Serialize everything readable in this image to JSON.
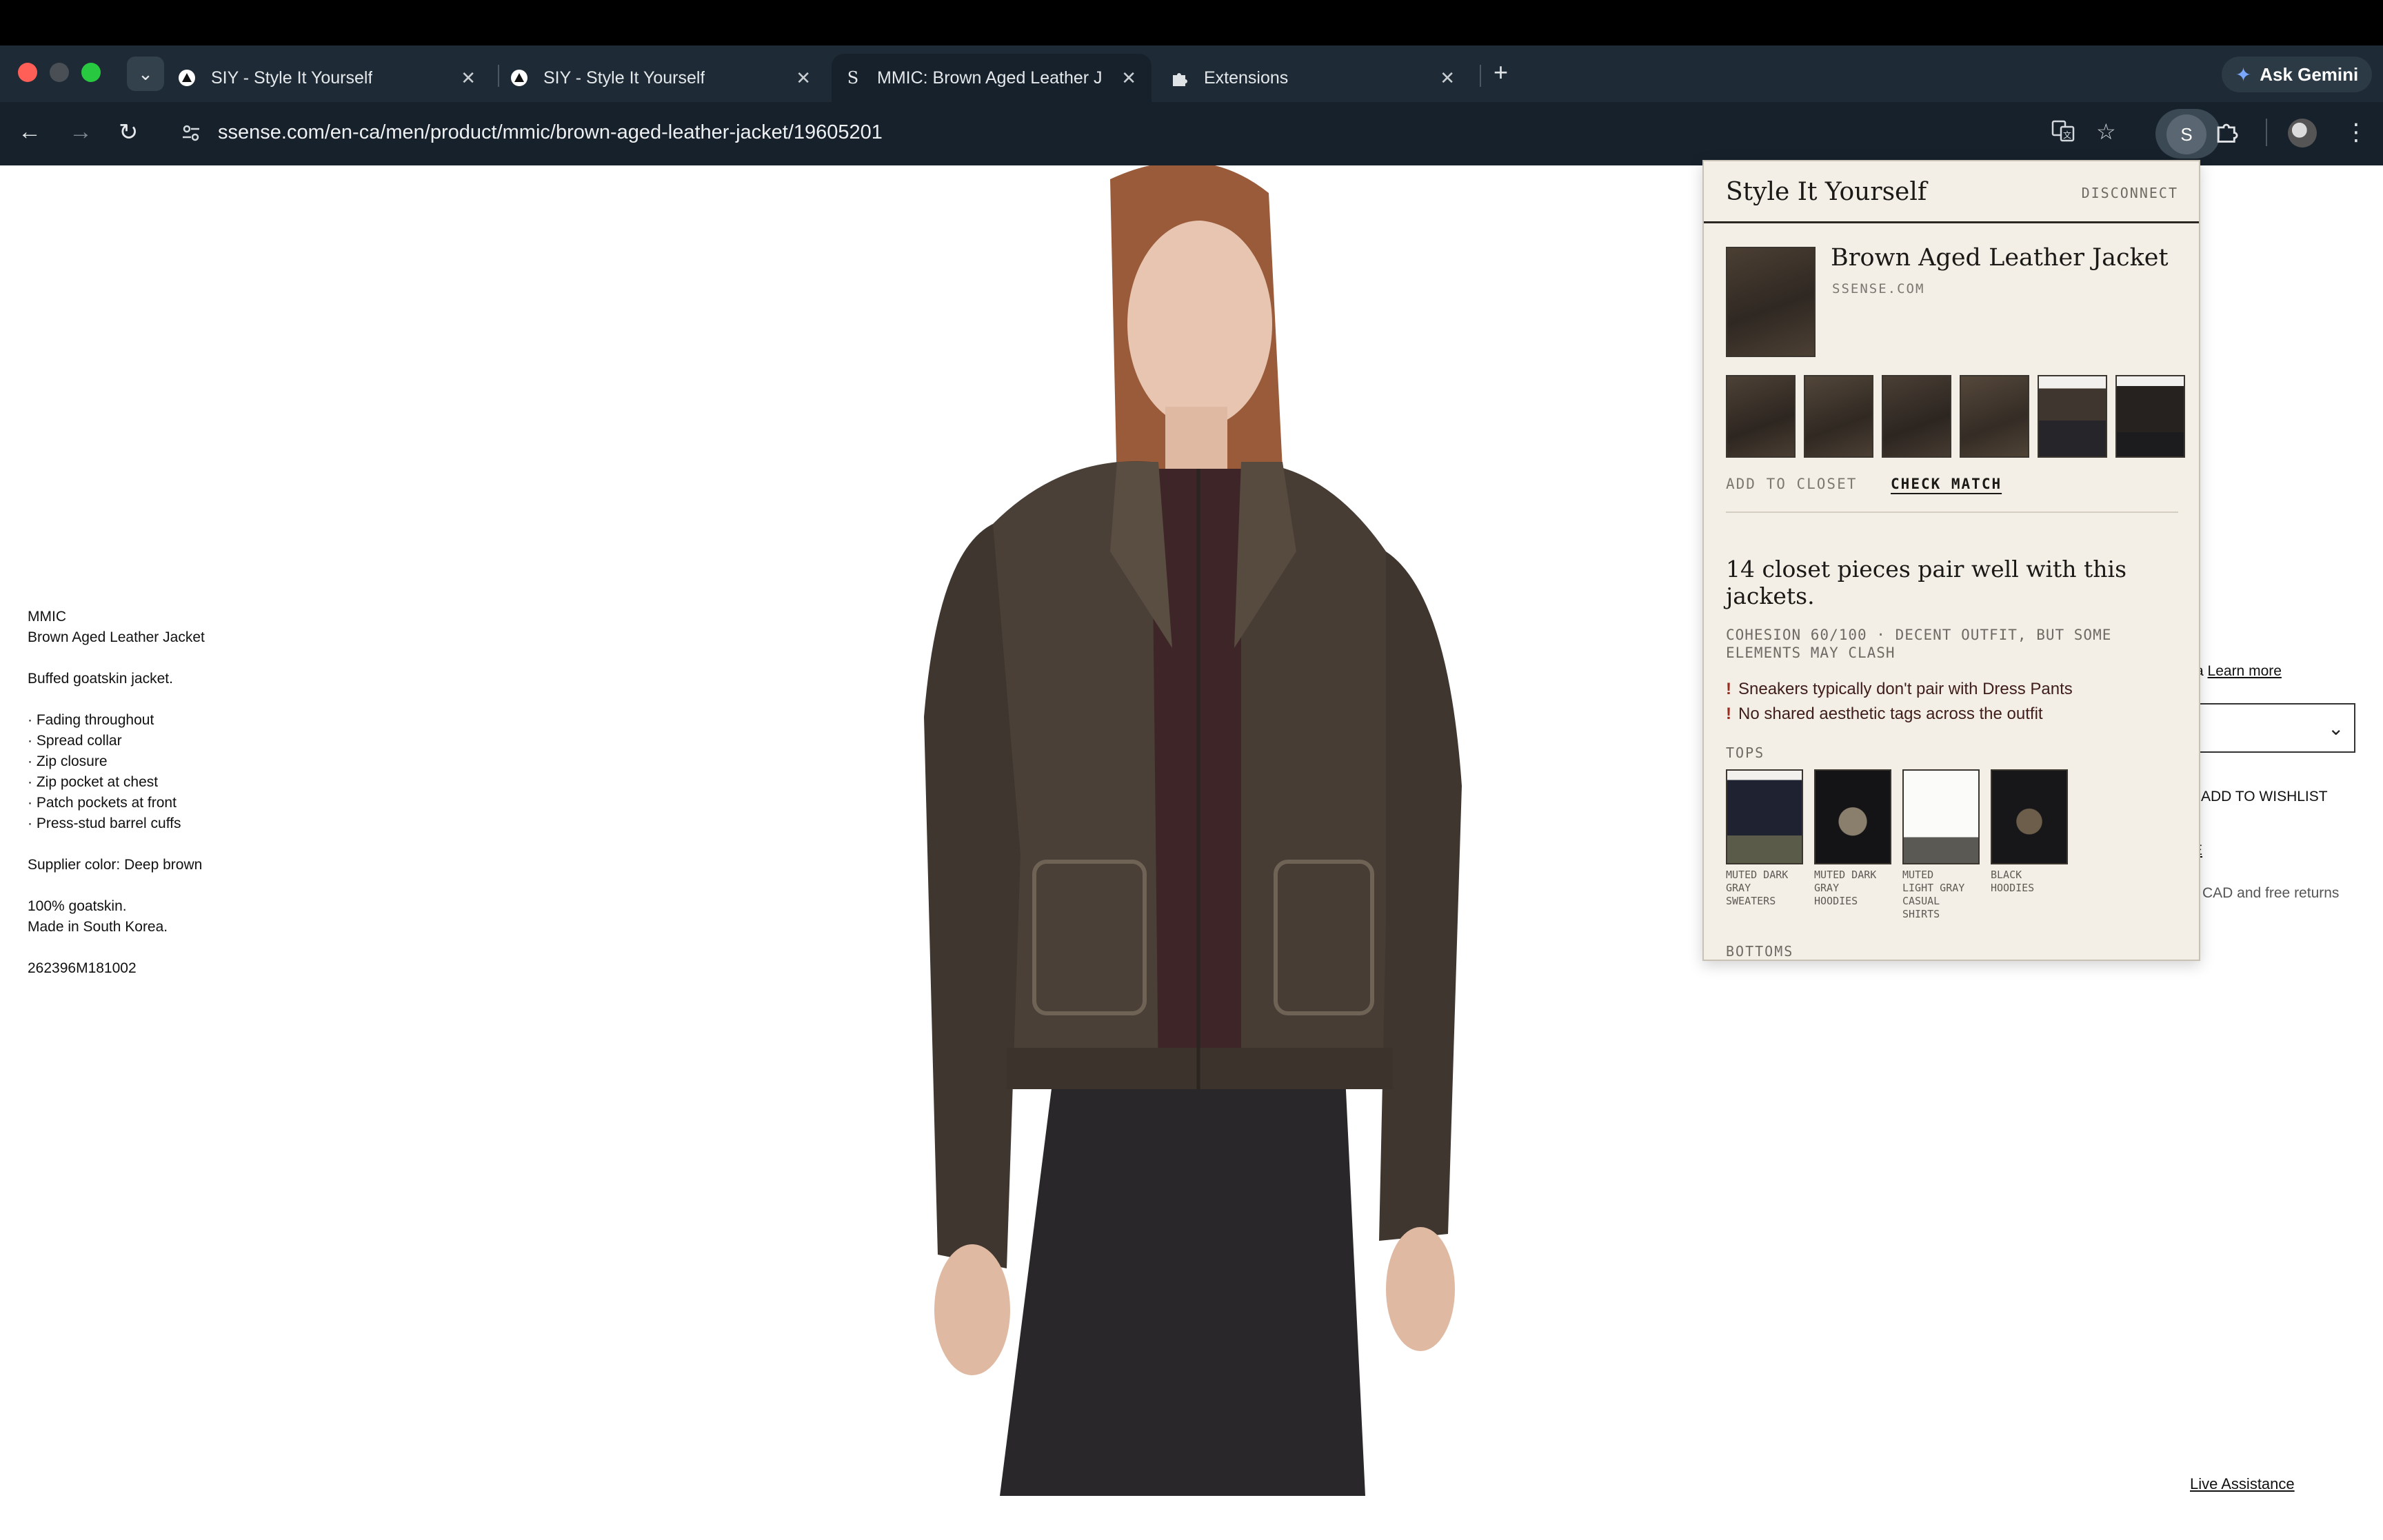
{
  "browser": {
    "tabs": [
      {
        "title": "SIY - Style It Yourself",
        "favicon": "triangle-logo-icon"
      },
      {
        "title": "SIY - Style It Yourself",
        "favicon": "triangle-logo-icon"
      },
      {
        "title": "MMIC: Brown Aged Leather J",
        "favicon": "letter-s-icon"
      },
      {
        "title": "Extensions",
        "favicon": "puzzle-icon"
      }
    ],
    "new_tab": "+",
    "gemini_label": "Ask Gemini",
    "url": "ssense.com/en-ca/men/product/mmic/brown-aged-leather-jacket/19605201",
    "extension_letter": "S"
  },
  "product": {
    "brand": "MMIC",
    "name": "Brown Aged Leather Jacket",
    "summary": "Buffed goatskin jacket.",
    "features": [
      "· Fading throughout",
      "· Spread collar",
      "· Zip closure",
      "· Zip pocket at chest",
      "· Patch pockets at front",
      "· Press-stud barrel cuffs"
    ],
    "supplier_color": "Supplier color: Deep brown",
    "material": "100% goatskin.",
    "origin": "Made in South Korea.",
    "sku": "262396M181002"
  },
  "page_fragments": {
    "learn_prefix": "a",
    "learn_more": "Learn more",
    "wishlist": "ADD TO WISHLIST",
    "shipping": "CAD and free returns",
    "underline_glyph": "E",
    "live_assistance": "Live Assistance"
  },
  "popup": {
    "title": "Style It Yourself",
    "disconnect": "DISCONNECT",
    "product_name": "Brown Aged Leather Jacket",
    "product_domain": "SSENSE.COM",
    "add_to_closet": "ADD TO CLOSET",
    "check_match": "CHECK MATCH",
    "headline": "14 closet pieces pair well with this jackets.",
    "cohesion": "COHESION 60/100 · DECENT OUTFIT, BUT SOME ELEMENTS MAY CLASH",
    "warnings": [
      "Sneakers typically don't pair with Dress Pants",
      "No shared aesthetic tags across the outfit"
    ],
    "warning_mark": "!",
    "tops_label": "TOPS",
    "tops": [
      {
        "label": "MUTED DARK\nGRAY\nSWEATERS"
      },
      {
        "label": "MUTED DARK\nGRAY\nHOODIES"
      },
      {
        "label": "MUTED\nLIGHT GRAY\nCASUAL\nSHIRTS"
      },
      {
        "label": "BLACK\nHOODIES"
      }
    ],
    "bottoms_label": "BOTTOMS"
  },
  "colors": {
    "tab_strip": "#1e2b36",
    "toolbar": "#16212b",
    "popup_bg": "#f3efe7",
    "warning_text": "#3f1d1a"
  }
}
